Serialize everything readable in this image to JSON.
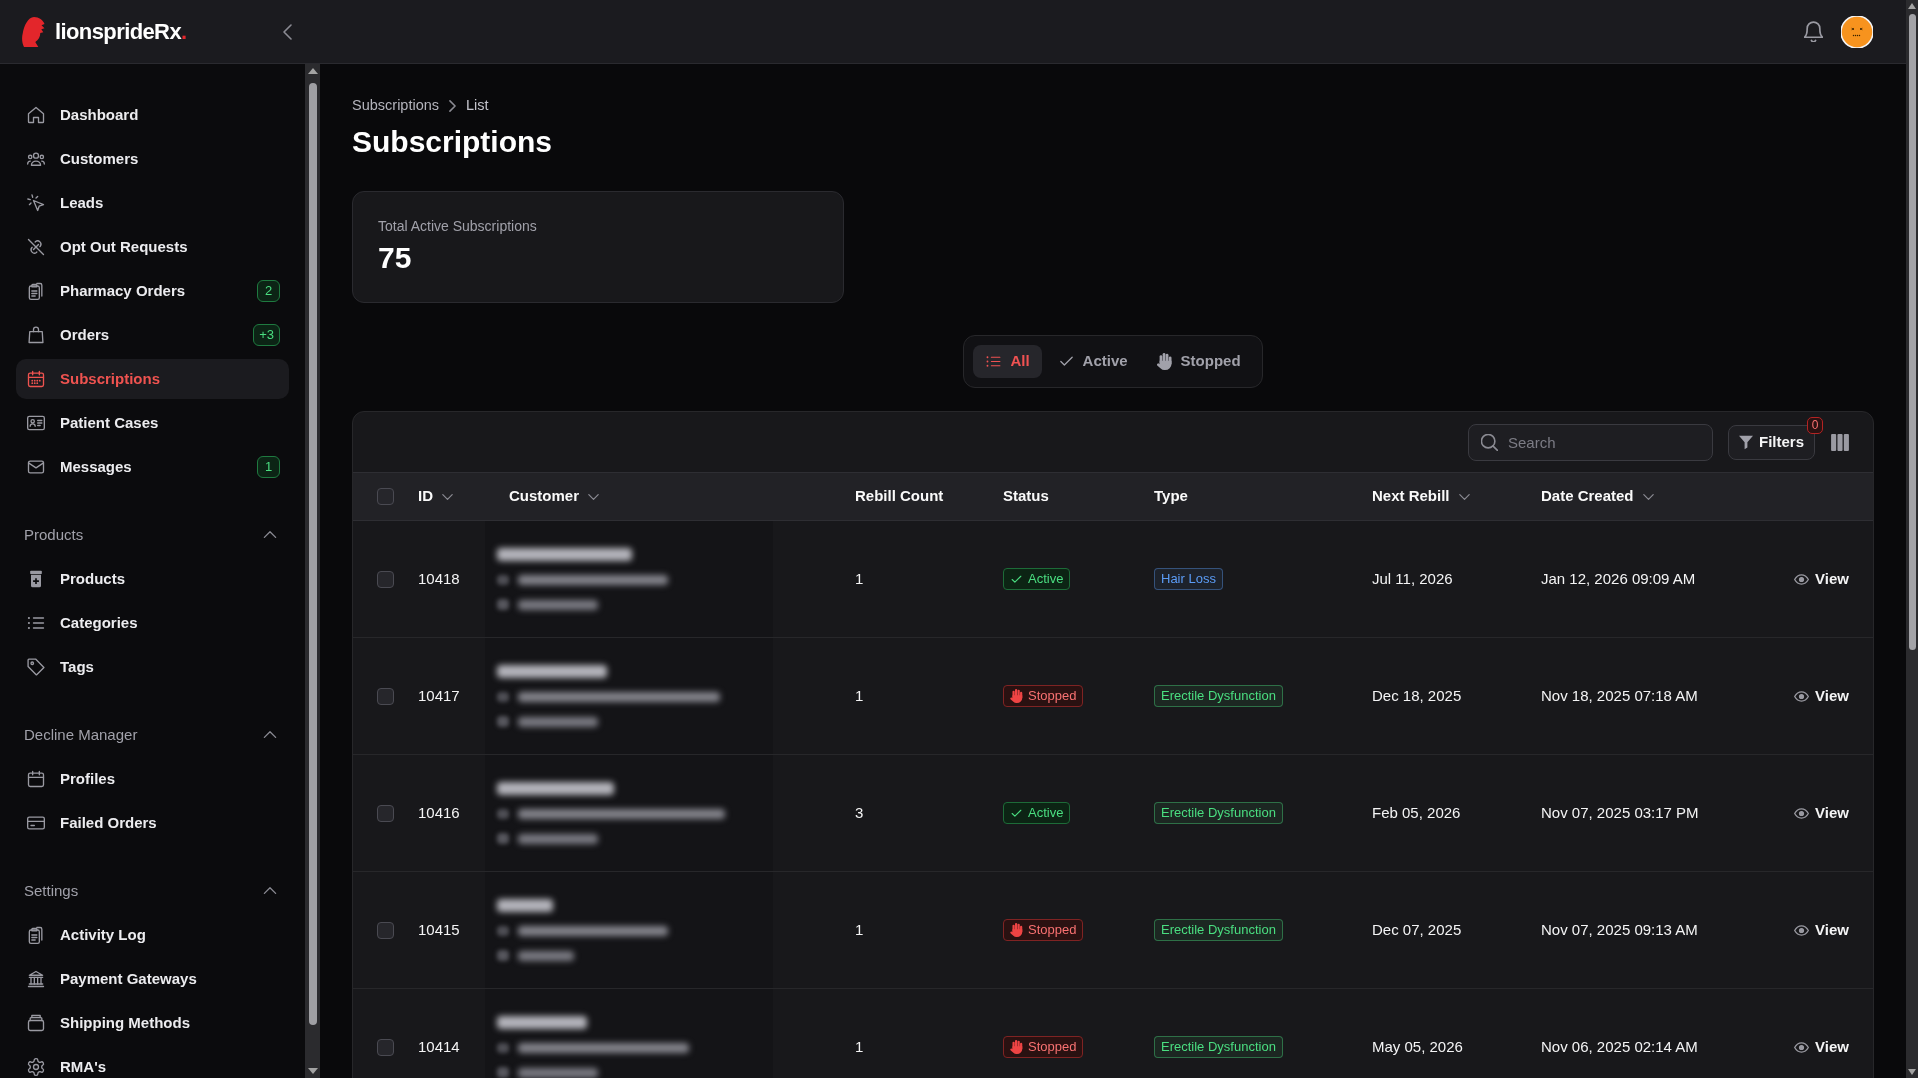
{
  "brand": {
    "name": "lionsprideRx",
    "dot": "."
  },
  "sidebar": {
    "items": [
      {
        "label": "Dashboard",
        "selected": false
      },
      {
        "label": "Customers",
        "selected": false
      },
      {
        "label": "Leads",
        "selected": false
      },
      {
        "label": "Opt Out Requests",
        "selected": false
      },
      {
        "label": "Pharmacy Orders",
        "selected": false,
        "badge": "2"
      },
      {
        "label": "Orders",
        "selected": false,
        "badge": "+3"
      },
      {
        "label": "Subscriptions",
        "selected": true
      },
      {
        "label": "Patient Cases",
        "selected": false
      },
      {
        "label": "Messages",
        "selected": false,
        "badge": "1"
      }
    ],
    "sections": [
      {
        "title": "Products",
        "expanded": true,
        "items": [
          {
            "label": "Products",
            "selected": false
          },
          {
            "label": "Categories",
            "selected": false
          },
          {
            "label": "Tags",
            "selected": false
          }
        ]
      },
      {
        "title": "Decline Manager",
        "expanded": true,
        "items": [
          {
            "label": "Profiles",
            "selected": false
          },
          {
            "label": "Failed Orders",
            "selected": false
          }
        ]
      },
      {
        "title": "Settings",
        "expanded": true,
        "items": [
          {
            "label": "Activity Log",
            "selected": false
          },
          {
            "label": "Payment Gateways",
            "selected": false
          },
          {
            "label": "Shipping Methods",
            "selected": false
          },
          {
            "label": "RMA's",
            "selected": false
          }
        ]
      }
    ]
  },
  "breadcrumb": [
    "Subscriptions",
    "List"
  ],
  "page_title": "Subscriptions",
  "stat_card": {
    "label": "Total Active Subscriptions",
    "value": "75"
  },
  "filter_tabs": [
    {
      "label": "All",
      "selected": true
    },
    {
      "label": "Active",
      "selected": false
    },
    {
      "label": "Stopped",
      "selected": false
    }
  ],
  "table": {
    "search": {
      "placeholder": "Search"
    },
    "filters_button": {
      "label": "Filters",
      "badge": "0"
    },
    "header_checkbox": {
      "checked": false
    },
    "columns": [
      {
        "label": "ID",
        "sortable": true
      },
      {
        "label": "Customer",
        "sortable": true
      },
      {
        "label": "Rebill Count",
        "sortable": false
      },
      {
        "label": "Status",
        "sortable": false
      },
      {
        "label": "Type",
        "sortable": false
      },
      {
        "label": "Next Rebill",
        "sortable": true
      },
      {
        "label": "Date Created",
        "sortable": true
      }
    ],
    "rows": [
      {
        "checked": false,
        "id": "10418",
        "rebill_count": "1",
        "status": {
          "label": "Active",
          "kind": "active"
        },
        "type": {
          "label": "Hair Loss",
          "color": "#5b9cf6"
        },
        "next_rebill": "Jul 11, 2026",
        "date_created": "Jan 12, 2026 09:09 AM",
        "action": "View"
      },
      {
        "checked": false,
        "id": "10417",
        "rebill_count": "1",
        "status": {
          "label": "Stopped",
          "kind": "stopped"
        },
        "type": {
          "label": "Erectile Dysfunction",
          "color": "#4ade80"
        },
        "next_rebill": "Dec 18, 2025",
        "date_created": "Nov 18, 2025 07:18 AM",
        "action": "View"
      },
      {
        "checked": false,
        "id": "10416",
        "rebill_count": "3",
        "status": {
          "label": "Active",
          "kind": "active"
        },
        "type": {
          "label": "Erectile Dysfunction",
          "color": "#4ade80"
        },
        "next_rebill": "Feb 05, 2026",
        "date_created": "Nov 07, 2025 03:17 PM",
        "action": "View"
      },
      {
        "checked": false,
        "id": "10415",
        "rebill_count": "1",
        "status": {
          "label": "Stopped",
          "kind": "stopped"
        },
        "type": {
          "label": "Erectile Dysfunction",
          "color": "#4ade80"
        },
        "next_rebill": "Dec 07, 2025",
        "date_created": "Nov 07, 2025 09:13 AM",
        "action": "View"
      },
      {
        "checked": false,
        "id": "10414",
        "rebill_count": "1",
        "status": {
          "label": "Stopped",
          "kind": "stopped"
        },
        "type": {
          "label": "Erectile Dysfunction",
          "color": "#4ade80"
        },
        "next_rebill": "May 05, 2026",
        "date_created": "Nov 06, 2025 02:14 AM",
        "action": "View"
      }
    ]
  }
}
